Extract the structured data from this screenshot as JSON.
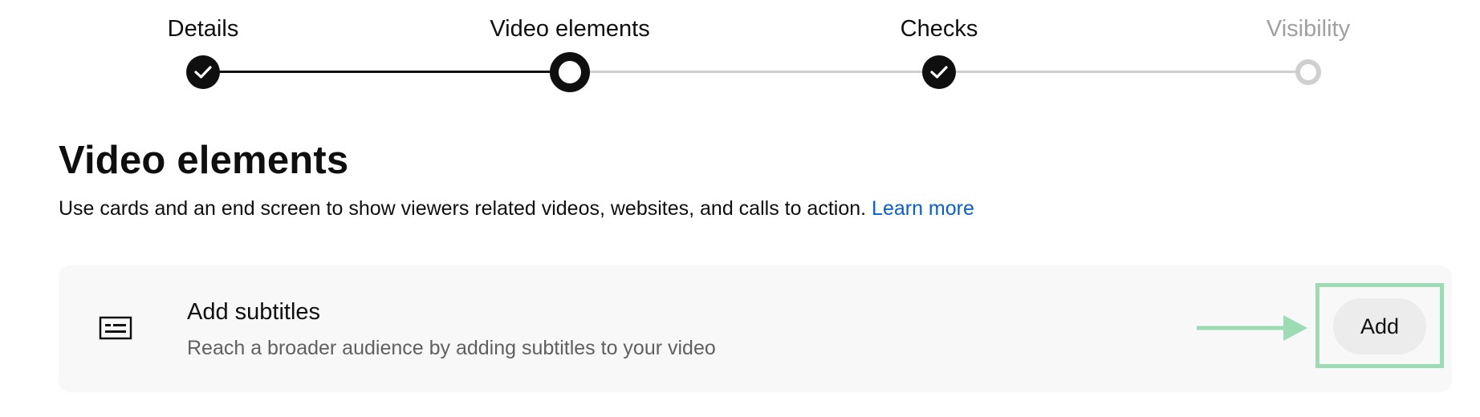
{
  "stepper": {
    "steps": [
      {
        "label": "Details",
        "status": "completed"
      },
      {
        "label": "Video elements",
        "status": "current"
      },
      {
        "label": "Checks",
        "status": "completed"
      },
      {
        "label": "Visibility",
        "status": "pending"
      }
    ]
  },
  "main": {
    "title": "Video elements",
    "description": "Use cards and an end screen to show viewers related videos, websites, and calls to action.",
    "learn_more": "Learn more"
  },
  "card": {
    "icon": "subtitles-icon",
    "title": "Add subtitles",
    "description": "Reach a broader audience by adding subtitles to your video",
    "button_label": "Add",
    "annotation": {
      "type": "arrow-and-highlight-box",
      "color": "#9bdcb4"
    }
  },
  "colors": {
    "link": "#065fd4",
    "step_done": "#0f0f0f",
    "step_todo": "#cfcfcf",
    "card_bg": "#f8f8f8"
  }
}
